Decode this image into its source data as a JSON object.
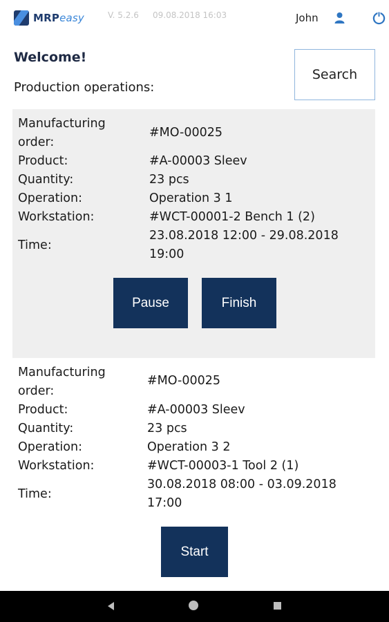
{
  "header": {
    "logo_main": "MRP",
    "logo_accent": "easy",
    "version": "V. 5.2.6",
    "datetime": "09.08.2018 16:03",
    "user": "John"
  },
  "welcome": "Welcome!",
  "section_title": "Production operations:",
  "search_label": "Search",
  "labels": {
    "mo_line1": "Manufacturing",
    "mo_line2": "order:",
    "product": "Product:",
    "quantity": "Quantity:",
    "operation": "Operation:",
    "workstation": "Workstation:",
    "time": "Time:"
  },
  "operations": [
    {
      "order": "#MO-00025",
      "product": "#A-00003 Sleev",
      "quantity": "23 pcs",
      "operation": "Operation 3 1",
      "workstation": "#WCT-00001-2 Bench 1 (2)",
      "time_line1": "23.08.2018 12:00 - 29.08.2018",
      "time_line2": "19:00",
      "buttons": [
        "Pause",
        "Finish"
      ]
    },
    {
      "order": "#MO-00025",
      "product": "#A-00003 Sleev",
      "quantity": "23 pcs",
      "operation": "Operation 3 2",
      "workstation": "#WCT-00003-1 Tool 2 (1)",
      "time_line1": "30.08.2018 08:00 - 03.09.2018",
      "time_line2": "17:00",
      "buttons": [
        "Start"
      ]
    }
  ],
  "colors": {
    "brand": "#1f3c6e",
    "button_bg": "#13325b",
    "active_card_bg": "#efefef",
    "accent": "#3a86d8"
  }
}
